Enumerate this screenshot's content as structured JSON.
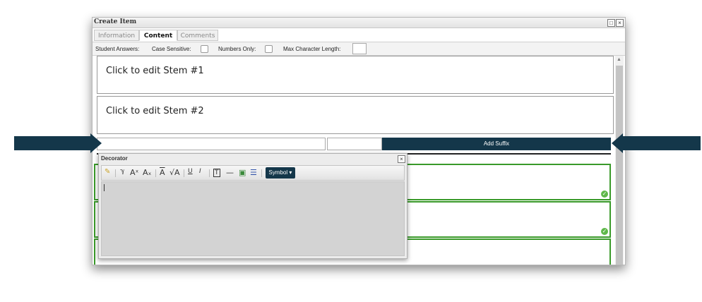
{
  "window": {
    "title": "Create Item",
    "buttons": {
      "restore": "□",
      "close": "×"
    }
  },
  "tabs": [
    {
      "label": "Information",
      "active": false
    },
    {
      "label": "Content",
      "active": true
    },
    {
      "label": "Comments",
      "active": false
    }
  ],
  "options": {
    "student_answers": "Student Answers:",
    "case_sensitive": "Case Sensitive:",
    "numbers_only": "Numbers Only:",
    "max_length": "Max Character Length:",
    "max_length_value": ""
  },
  "stems": [
    {
      "text": "Click to edit Stem #1"
    },
    {
      "text": "Click to edit Stem #2"
    }
  ],
  "suffix_row": {
    "input_value": "",
    "button_label": "Add Suffix"
  },
  "decorator": {
    "title": "Decorator",
    "close": "×",
    "symbol_label": "Symbol ▾",
    "toolbar_icons": [
      "edit-icon",
      "spellcheck-icon",
      "superscript-icon",
      "subscript-icon",
      "overline-icon",
      "sqrt-icon",
      "underline-icon",
      "italic-icon",
      "textbox-icon",
      "horizontal-line-icon",
      "image-icon",
      "list-icon"
    ]
  },
  "colors": {
    "accent": "#14374a",
    "answer_border": "#3a9a2a",
    "check": "#5fb84a"
  }
}
